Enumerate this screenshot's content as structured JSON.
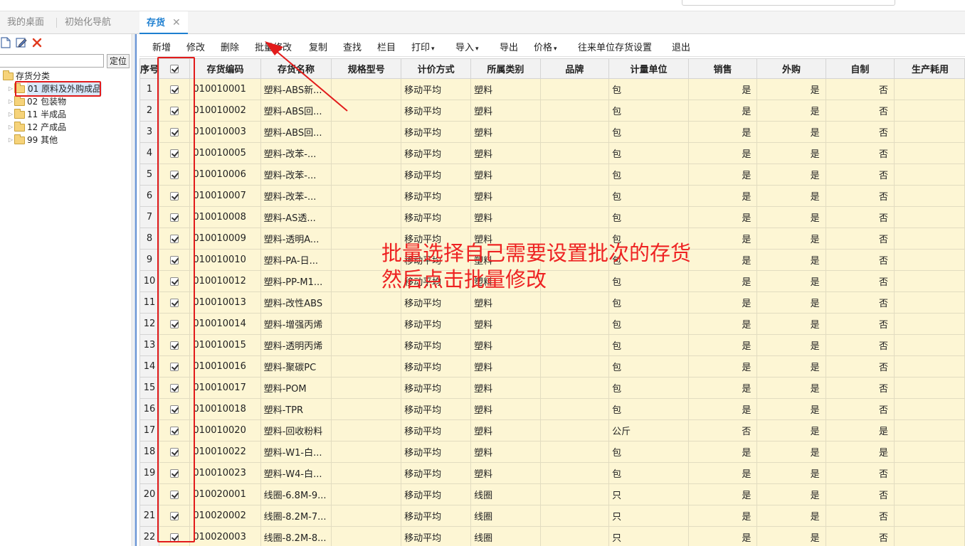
{
  "tabs": [
    {
      "label": "我的桌面",
      "active": false
    },
    {
      "label": "初始化导航",
      "active": false
    },
    {
      "label": "存货",
      "active": true
    }
  ],
  "tab_close_glyph": "✕",
  "left_panel": {
    "locate_button": "定位",
    "locate_placeholder": "",
    "tree_root": "存货分类",
    "tree_items": [
      {
        "label": "01 原料及外购成品",
        "selected": true
      },
      {
        "label": "02 包装物",
        "selected": false
      },
      {
        "label": "11 半成品",
        "selected": false
      },
      {
        "label": "12 产成品",
        "selected": false
      },
      {
        "label": "99 其他",
        "selected": false
      }
    ],
    "tool_icons": [
      "new-doc-icon",
      "edit-icon",
      "delete-icon"
    ]
  },
  "toolbar": [
    {
      "label": "新增",
      "dropdown": false
    },
    {
      "label": "修改",
      "dropdown": false
    },
    {
      "label": "删除",
      "dropdown": false
    },
    {
      "label": "批量修改",
      "dropdown": false
    },
    {
      "label": "复制",
      "dropdown": false
    },
    {
      "label": "查找",
      "dropdown": false
    },
    {
      "label": "栏目",
      "dropdown": false
    },
    {
      "label": "打印",
      "dropdown": true
    },
    {
      "label": "导入",
      "dropdown": true
    },
    {
      "label": "导出",
      "dropdown": false
    },
    {
      "label": "价格",
      "dropdown": true
    },
    {
      "label": "往来单位存货设置",
      "dropdown": false
    },
    {
      "label": "退出",
      "dropdown": false
    }
  ],
  "table": {
    "columns": [
      "序号",
      "",
      "存货编码",
      "存货名称",
      "规格型号",
      "计价方式",
      "所属类别",
      "品牌",
      "计量单位",
      "销售",
      "外购",
      "自制",
      "生产耗用"
    ],
    "rows": [
      {
        "no": "1",
        "checked": true,
        "code": "010010001",
        "name": "塑料-ABS新...",
        "spec": "",
        "method": "移动平均",
        "category": "塑料",
        "brand": "",
        "unit": "包",
        "sale": "是",
        "purchase": "是",
        "self": "否"
      },
      {
        "no": "2",
        "checked": true,
        "code": "010010002",
        "name": "塑料-ABS回...",
        "spec": "",
        "method": "移动平均",
        "category": "塑料",
        "brand": "",
        "unit": "包",
        "sale": "是",
        "purchase": "是",
        "self": "否"
      },
      {
        "no": "3",
        "checked": true,
        "code": "010010003",
        "name": "塑料-ABS回...",
        "spec": "",
        "method": "移动平均",
        "category": "塑料",
        "brand": "",
        "unit": "包",
        "sale": "是",
        "purchase": "是",
        "self": "否"
      },
      {
        "no": "4",
        "checked": true,
        "code": "010010005",
        "name": "塑料-改苯-...",
        "spec": "",
        "method": "移动平均",
        "category": "塑料",
        "brand": "",
        "unit": "包",
        "sale": "是",
        "purchase": "是",
        "self": "否"
      },
      {
        "no": "5",
        "checked": true,
        "code": "010010006",
        "name": "塑料-改苯-...",
        "spec": "",
        "method": "移动平均",
        "category": "塑料",
        "brand": "",
        "unit": "包",
        "sale": "是",
        "purchase": "是",
        "self": "否"
      },
      {
        "no": "6",
        "checked": true,
        "code": "010010007",
        "name": "塑料-改苯-...",
        "spec": "",
        "method": "移动平均",
        "category": "塑料",
        "brand": "",
        "unit": "包",
        "sale": "是",
        "purchase": "是",
        "self": "否"
      },
      {
        "no": "7",
        "checked": true,
        "code": "010010008",
        "name": "塑料-AS透...",
        "spec": "",
        "method": "移动平均",
        "category": "塑料",
        "brand": "",
        "unit": "包",
        "sale": "是",
        "purchase": "是",
        "self": "否"
      },
      {
        "no": "8",
        "checked": true,
        "code": "010010009",
        "name": "塑料-透明A...",
        "spec": "",
        "method": "移动平均",
        "category": "塑料",
        "brand": "",
        "unit": "包",
        "sale": "是",
        "purchase": "是",
        "self": "否"
      },
      {
        "no": "9",
        "checked": true,
        "code": "010010010",
        "name": "塑料-PA-日...",
        "spec": "",
        "method": "移动平均",
        "category": "塑料",
        "brand": "",
        "unit": "包",
        "sale": "是",
        "purchase": "是",
        "self": "否"
      },
      {
        "no": "10",
        "checked": true,
        "code": "010010012",
        "name": "塑料-PP-M1...",
        "spec": "",
        "method": "移动平均",
        "category": "塑料",
        "brand": "",
        "unit": "包",
        "sale": "是",
        "purchase": "是",
        "self": "否"
      },
      {
        "no": "11",
        "checked": true,
        "code": "010010013",
        "name": "塑料-改性ABS",
        "spec": "",
        "method": "移动平均",
        "category": "塑料",
        "brand": "",
        "unit": "包",
        "sale": "是",
        "purchase": "是",
        "self": "否"
      },
      {
        "no": "12",
        "checked": true,
        "code": "010010014",
        "name": "塑料-增强丙烯",
        "spec": "",
        "method": "移动平均",
        "category": "塑料",
        "brand": "",
        "unit": "包",
        "sale": "是",
        "purchase": "是",
        "self": "否"
      },
      {
        "no": "13",
        "checked": true,
        "code": "010010015",
        "name": "塑料-透明丙烯",
        "spec": "",
        "method": "移动平均",
        "category": "塑料",
        "brand": "",
        "unit": "包",
        "sale": "是",
        "purchase": "是",
        "self": "否"
      },
      {
        "no": "14",
        "checked": true,
        "code": "010010016",
        "name": "塑料-聚碳PC",
        "spec": "",
        "method": "移动平均",
        "category": "塑料",
        "brand": "",
        "unit": "包",
        "sale": "是",
        "purchase": "是",
        "self": "否"
      },
      {
        "no": "15",
        "checked": true,
        "code": "010010017",
        "name": "塑料-POM",
        "spec": "",
        "method": "移动平均",
        "category": "塑料",
        "brand": "",
        "unit": "包",
        "sale": "是",
        "purchase": "是",
        "self": "否"
      },
      {
        "no": "16",
        "checked": true,
        "code": "010010018",
        "name": "塑料-TPR",
        "spec": "",
        "method": "移动平均",
        "category": "塑料",
        "brand": "",
        "unit": "包",
        "sale": "是",
        "purchase": "是",
        "self": "否"
      },
      {
        "no": "17",
        "checked": true,
        "code": "010010020",
        "name": "塑料-回收粉料",
        "spec": "",
        "method": "移动平均",
        "category": "塑料",
        "brand": "",
        "unit": "公斤",
        "sale": "否",
        "purchase": "是",
        "self": "是"
      },
      {
        "no": "18",
        "checked": true,
        "code": "010010022",
        "name": "塑料-W1-白...",
        "spec": "",
        "method": "移动平均",
        "category": "塑料",
        "brand": "",
        "unit": "包",
        "sale": "是",
        "purchase": "是",
        "self": "是"
      },
      {
        "no": "19",
        "checked": true,
        "code": "010010023",
        "name": "塑料-W4-白...",
        "spec": "",
        "method": "移动平均",
        "category": "塑料",
        "brand": "",
        "unit": "包",
        "sale": "是",
        "purchase": "是",
        "self": "否"
      },
      {
        "no": "20",
        "checked": true,
        "code": "010020001",
        "name": "线圈-6.8M-9...",
        "spec": "",
        "method": "移动平均",
        "category": "线圈",
        "brand": "",
        "unit": "只",
        "sale": "是",
        "purchase": "是",
        "self": "否"
      },
      {
        "no": "21",
        "checked": true,
        "code": "010020002",
        "name": "线圈-8.2M-7...",
        "spec": "",
        "method": "移动平均",
        "category": "线圈",
        "brand": "",
        "unit": "只",
        "sale": "是",
        "purchase": "是",
        "self": "否"
      },
      {
        "no": "22",
        "checked": true,
        "code": "010020003",
        "name": "线圈-8.2M-8...",
        "spec": "",
        "method": "移动平均",
        "category": "线圈",
        "brand": "",
        "unit": "只",
        "sale": "是",
        "purchase": "是",
        "self": "否"
      }
    ]
  },
  "annotation": {
    "lines": [
      "批量选择自己需要设置批次的存货",
      "然后点击批量修改"
    ],
    "color": "#ee2222"
  },
  "colors": {
    "accent": "#1e7fd0",
    "highlight_red": "#e21b1b",
    "row_bg": "#fdf6d4"
  }
}
